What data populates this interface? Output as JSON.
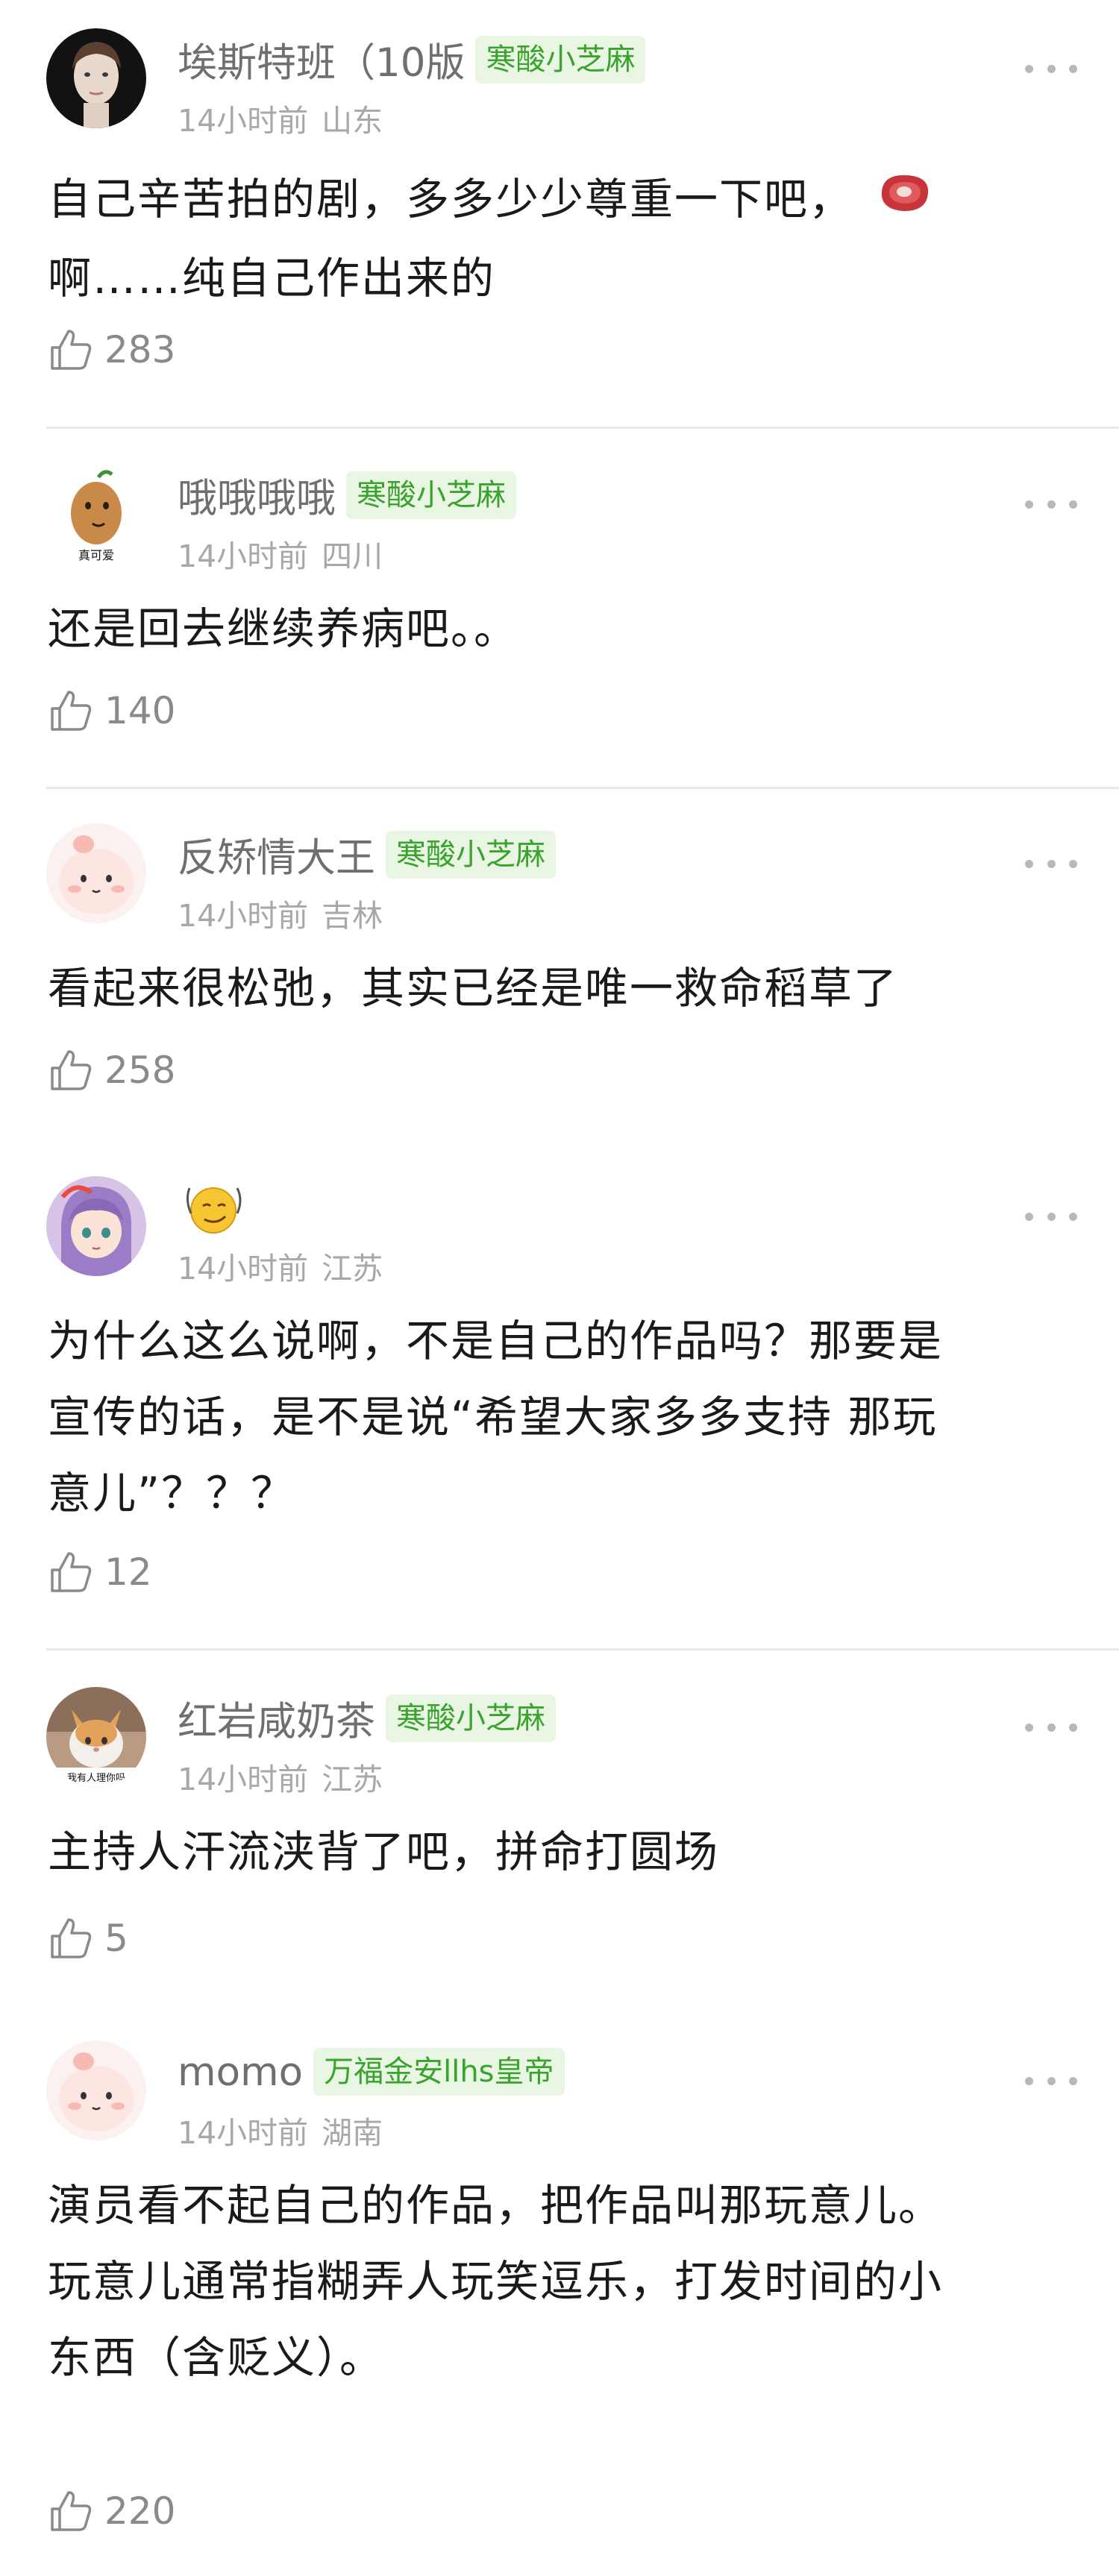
{
  "comments": [
    {
      "username": "埃斯特班（10版",
      "badge": "寒酸小芝麻",
      "time": "14小时前",
      "location": "山东",
      "line1": "自己辛苦拍的剧，多多少少尊重一下吧，",
      "line2": "啊……纯自己作出来的",
      "likes": "283",
      "avatar_icon": "portrait-photo",
      "inline_icon": "steak-emoji"
    },
    {
      "username": "哦哦哦哦",
      "badge": "寒酸小芝麻",
      "time": "14小时前",
      "location": "四川",
      "line1": "还是回去继续养病吧。。",
      "likes": "140",
      "avatar_icon": "cartoon-potato-avatar",
      "avatar_text": "真可爱"
    },
    {
      "username": "反矫情大王",
      "badge": "寒酸小芝麻",
      "time": "14小时前",
      "location": "吉林",
      "line1": "看起来很松弛，其实已经是唯一救命稻草了",
      "likes": "258",
      "avatar_icon": "cartoon-blob-avatar"
    },
    {
      "username": "",
      "time": "14小时前",
      "location": "江苏",
      "line1": "为什么这么说啊，不是自己的作品吗？那要是",
      "line2": "宣传的话，是不是说“希望大家多多支持 那玩",
      "line3": "意儿”？？？",
      "likes": "12",
      "avatar_icon": "anime-girl-avatar",
      "name_icon": "smirk-emoji"
    },
    {
      "username": "红岩咸奶茶",
      "badge": "寒酸小芝麻",
      "time": "14小时前",
      "location": "江苏",
      "line1": "主持人汗流浃背了吧，拼命打圆场",
      "likes": "5",
      "avatar_icon": "cat-photo-avatar",
      "avatar_text": "我有人理你吗"
    },
    {
      "username": "momo",
      "badge": "万福金安llhs皇帝",
      "time": "14小时前",
      "location": "湖南",
      "line1": "演员看不起自己的作品，把作品叫那玩意儿。",
      "line2": "玩意儿通常指糊弄人玩笑逗乐，打发时间的小",
      "line3": "东西（含贬义）。",
      "likes": "220",
      "avatar_icon": "cartoon-blob-avatar"
    }
  ],
  "colors": {
    "badge_bg": "#eaf6e4",
    "badge_text": "#3aa32e",
    "username": "#6f6f6f",
    "meta": "#a8a8a8",
    "divider": "#e9e9e9"
  },
  "icons": {
    "more": "more-dots-icon",
    "like": "thumbs-up-icon"
  }
}
